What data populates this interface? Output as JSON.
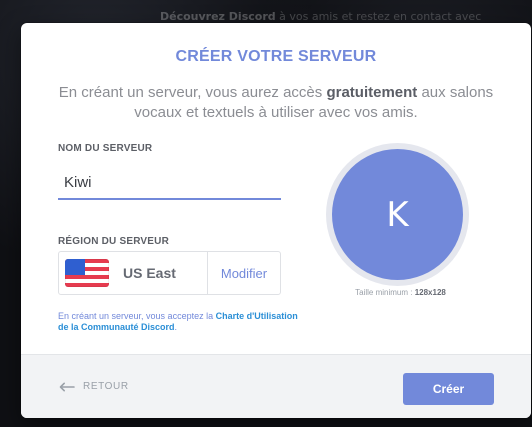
{
  "background": {
    "banner_bold": "Découvrez Discord",
    "banner_text": " à vos amis et restez en contact avec"
  },
  "modal": {
    "title": "CRÉER VOTRE SERVEUR",
    "subtitle": {
      "prefix": "En créant un serveur, vous aurez accès ",
      "bold": "gratuitement",
      "suffix": " aux salons vocaux et textuels à utiliser avec vos amis."
    },
    "server_name": {
      "label": "NOM DU SERVEUR",
      "value": "Kiwi",
      "placeholder": ""
    },
    "server_region": {
      "label": "RÉGION DU SERVEUR",
      "flag_icon": "us-flag-icon",
      "value": "US East",
      "modify_label": "Modifier"
    },
    "terms": {
      "prefix": "En créant un serveur, vous acceptez la ",
      "link": "Charte d'Utilisation de la Communauté Discord",
      "suffix": "."
    },
    "avatar": {
      "initial": "K",
      "min_size_prefix": "Taille minimum : ",
      "min_size_value": "128x128"
    },
    "footer": {
      "back_label": "RETOUR",
      "create_label": "Créer"
    }
  },
  "colors": {
    "accent": "#7289da",
    "link": "#2b8fd6",
    "modal_bg": "#ffffff",
    "footer_bg": "#f2f3f5",
    "flag_red": "#e63b4f",
    "flag_blue": "#2f5fd0"
  },
  "icons": {
    "back_icon": "arrow-left-icon",
    "region_flag_icon": "us-flag-icon"
  }
}
